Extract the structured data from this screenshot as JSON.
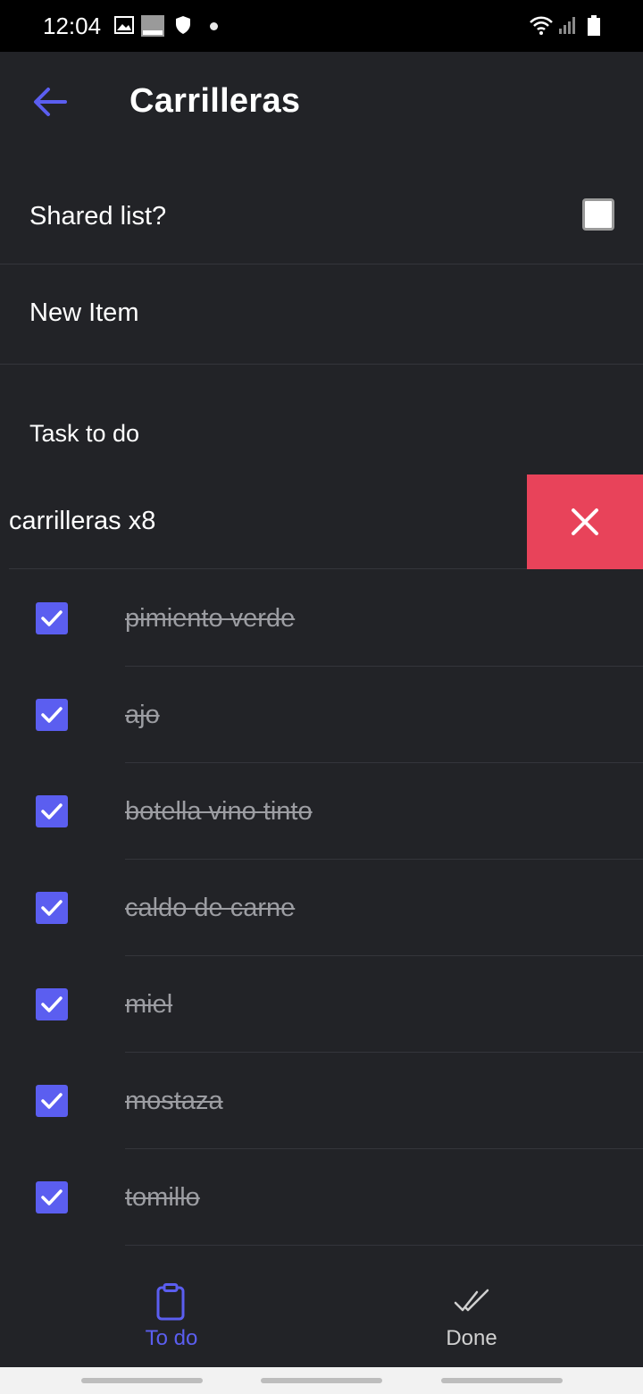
{
  "status_bar": {
    "time": "12:04"
  },
  "app_bar": {
    "title": "Carrilleras"
  },
  "shared": {
    "label": "Shared list?",
    "checked": false
  },
  "new_item": {
    "label": "New Item"
  },
  "section": {
    "label": "Task to do"
  },
  "pending_item": {
    "label": "carrilleras x8"
  },
  "done_items": [
    {
      "label": "pimiento verde"
    },
    {
      "label": "ajo"
    },
    {
      "label": "botella vino tinto"
    },
    {
      "label": "caldo de carne"
    },
    {
      "label": "miel"
    },
    {
      "label": "mostaza"
    },
    {
      "label": "tomillo"
    }
  ],
  "bottom_nav": {
    "todo": {
      "label": "To do",
      "active": true
    },
    "done": {
      "label": "Done",
      "active": false
    }
  },
  "colors": {
    "background": "#222327",
    "accent": "#5b5ef0",
    "delete": "#e8435a",
    "done_text": "#9c9da2",
    "inactive_nav": "#d0d0d0"
  }
}
